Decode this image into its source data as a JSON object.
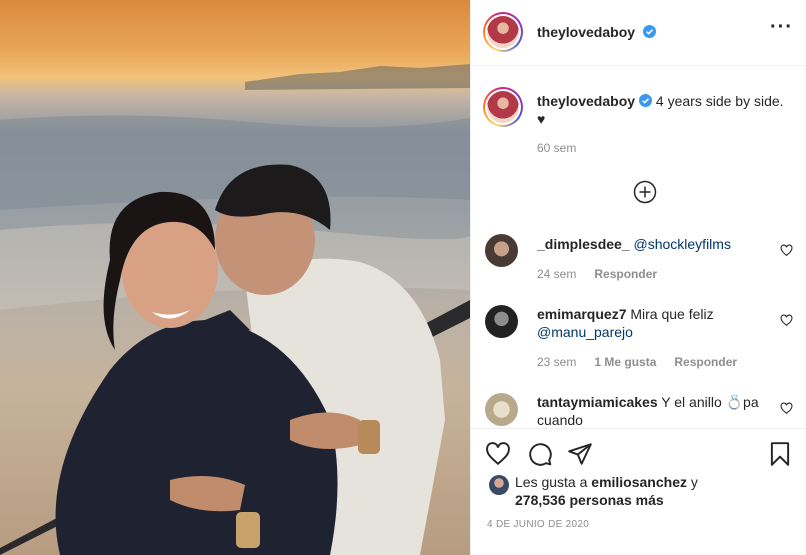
{
  "post": {
    "username": "theylovedaboy",
    "verified": true,
    "more_icon": "more-horizontal-icon",
    "caption": "4 years side by side. ♥",
    "caption_time": "60 sem",
    "load_more_icon": "plus-circle-icon"
  },
  "comments": [
    {
      "username": "_dimplesdee_",
      "mention": "@shockleyfilms",
      "text": "",
      "time": "24 sem",
      "likes": "",
      "reply": "Responder"
    },
    {
      "username": "emimarquez7",
      "text": "Mira que feliz",
      "mention": "@manu_parejo",
      "time": "23 sem",
      "likes": "1 Me gusta",
      "reply": "Responder"
    },
    {
      "username": "tantaymiamicakes",
      "text": "Y el anillo 💍pa cuando",
      "mention": ""
    }
  ],
  "actions": {
    "like_icon": "heart-icon",
    "comment_icon": "comment-icon",
    "share_icon": "paper-plane-icon",
    "save_icon": "bookmark-icon"
  },
  "likes": {
    "prefix": "Les gusta a",
    "first_user": "emiliosanchez",
    "joiner": "y",
    "others": "278,536 personas más"
  },
  "date": "4 DE JUNIO DE 2020",
  "colors": {
    "verified_blue": "#3897f0",
    "mention_blue": "#00376b",
    "meta_gray": "#8e8e8e"
  }
}
